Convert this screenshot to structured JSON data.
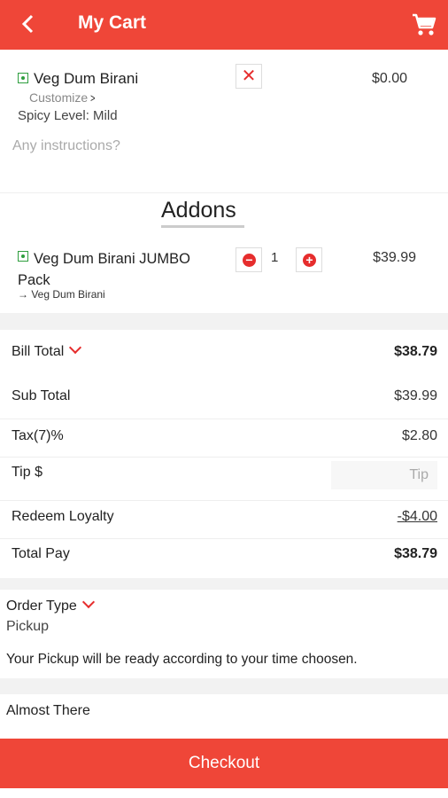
{
  "header": {
    "title": "My Cart",
    "back_icon": "back-chevron-icon",
    "cart_icon": "cart-icon"
  },
  "cart_item": {
    "name": "Veg Dum Birani",
    "customize_label": "Customize",
    "spicy_level": "Spicy Level: Mild",
    "instructions_placeholder": "Any instructions?",
    "remove_symbol": "✕",
    "price": "$0.00"
  },
  "addons": {
    "heading": "Addons",
    "items": [
      {
        "name": "Veg Dum Birani JUMBO Pack",
        "parent": "→ Veg Dum Birani",
        "quantity": "1",
        "price": "$39.99"
      }
    ]
  },
  "bill": {
    "bill_total_label": "Bill Total",
    "bill_total_value": "$38.79",
    "sub_total_label": "Sub Total",
    "sub_total_value": "$39.99",
    "tax_label": "Tax(7)%",
    "tax_value": "$2.80",
    "tip_label": "Tip $",
    "tip_placeholder": "Tip",
    "loyalty_label": "Redeem Loyalty",
    "loyalty_value": "-$4.00",
    "total_pay_label": "Total Pay",
    "total_pay_value": "$38.79"
  },
  "order": {
    "type_label": "Order Type",
    "type_value": "Pickup",
    "message": "Your Pickup will be ready according to your time choosen."
  },
  "almost_there": "Almost There",
  "checkout_label": "Checkout",
  "colors": {
    "brand": "#ef4638",
    "accent_red": "#e62d2d",
    "veg_green": "#2e9e3e",
    "link_blue": "#3b6fd8"
  }
}
